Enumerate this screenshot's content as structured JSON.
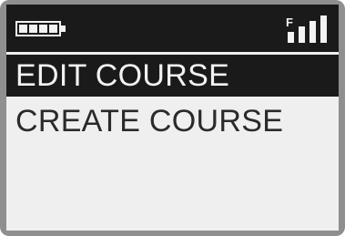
{
  "status_bar": {
    "battery_icon": "battery-full-icon",
    "battery_level": 1.0,
    "signal_icon": "signal-strength-icon",
    "signal_label": "F"
  },
  "menu": {
    "items": [
      {
        "label": "EDIT COURSE",
        "selected": true
      },
      {
        "label": "CREATE COURSE",
        "selected": false
      }
    ]
  },
  "colors": {
    "lcd_background": "#efefef",
    "highlight": "#1a1a1a",
    "text": "#2a2a2a",
    "bezel": "#8f8f8f"
  }
}
